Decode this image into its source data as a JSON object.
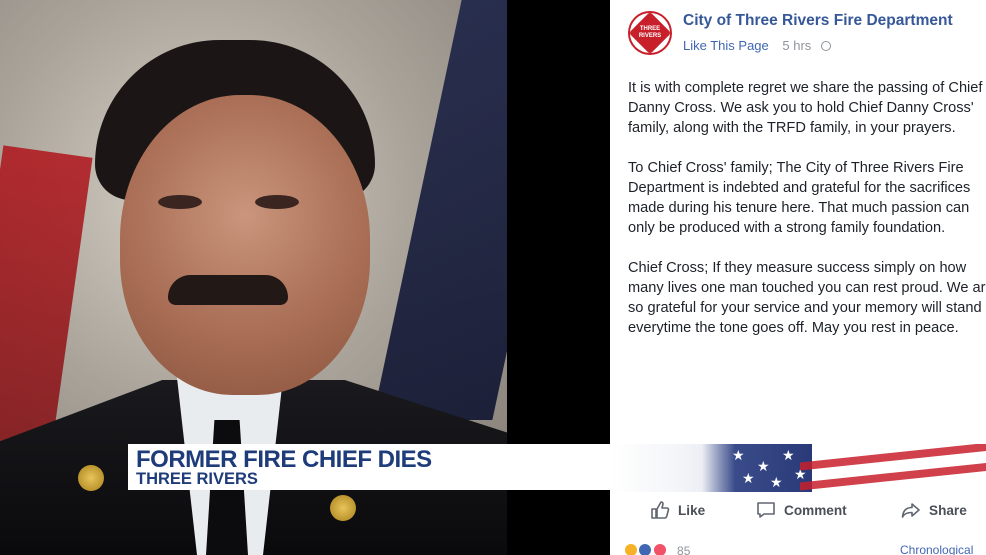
{
  "post": {
    "page_name": "City of Three Rivers Fire Department",
    "logo_text": "THREE RIVERS",
    "like_page": "Like This Page",
    "time": "5 hrs",
    "paragraphs": [
      "It is with complete regret we share the passing of Chief Danny Cross. We ask you to hold Chief Danny Cross' family, along with the TRFD family, in your prayers.",
      "To Chief Cross' family; The City of Three Rivers Fire Department is indebted and grateful for the sacrifices made during his tenure here. That much passion can only be produced with a strong family foundation.",
      "Chief Cross; If they measure success simply on how many lives one man touched you can rest proud. We are so grateful for your service and your memory will stand everytime the tone goes off. May you rest in peace."
    ],
    "actions": {
      "like": "Like",
      "comment": "Comment",
      "share": "Share"
    },
    "reaction_count": "85",
    "sort_label": "Chronological"
  },
  "lower_third": {
    "headline": "FORMER FIRE CHIEF DIES",
    "subline": "THREE RIVERS"
  },
  "colors": {
    "facebook_blue": "#365899",
    "lower_third_text": "#1e3b7a",
    "brand_red": "#c8202b"
  }
}
